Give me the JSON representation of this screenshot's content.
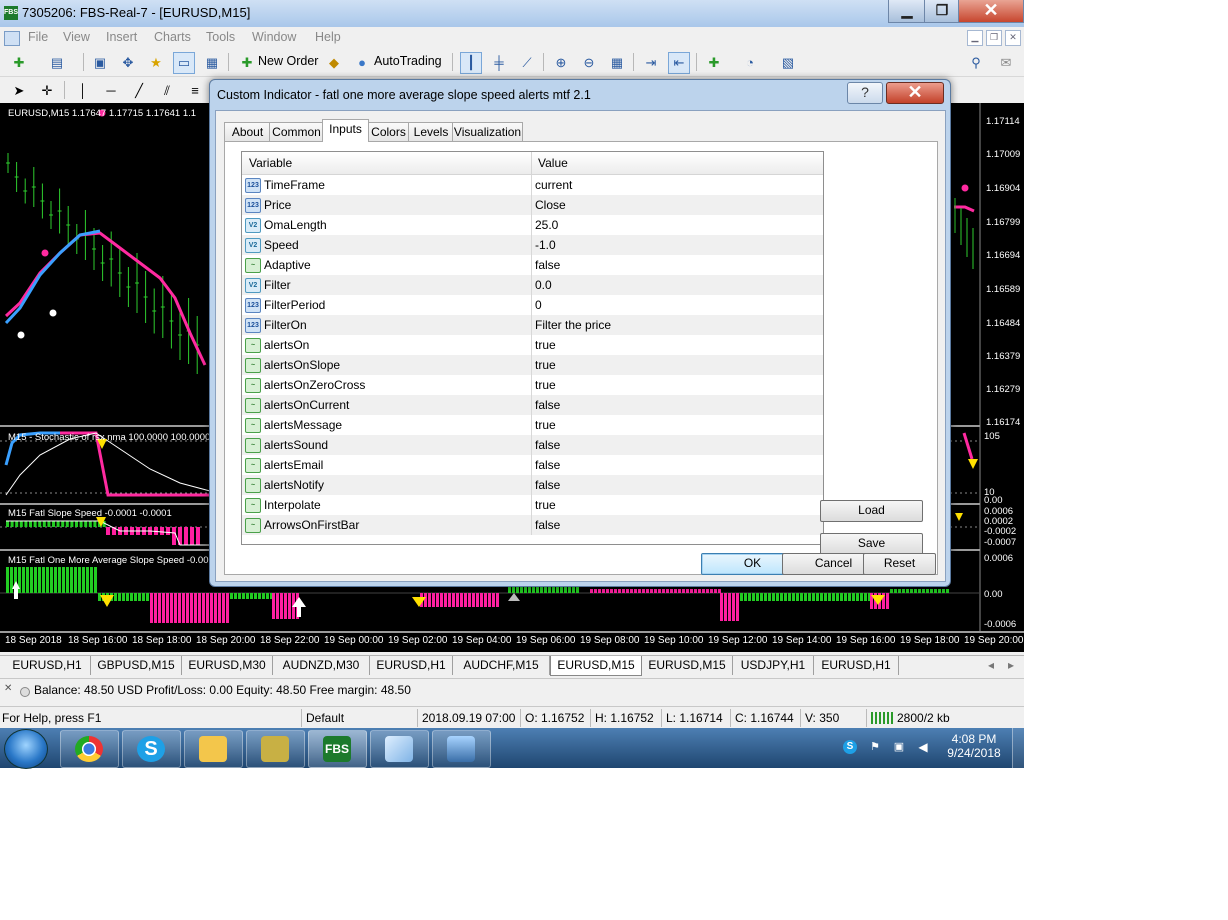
{
  "window": {
    "app_icon": "FBS",
    "title": "7305206: FBS-Real-7 - [EURUSD,M15]",
    "buttons": {
      "minimize": "▁",
      "maximize": "❐",
      "close": "✕"
    }
  },
  "menu": [
    "File",
    "View",
    "Insert",
    "Charts",
    "Tools",
    "Window",
    "Help"
  ],
  "toolbar": {
    "new_order": "New Order",
    "autotrading": "AutoTrading"
  },
  "chart": {
    "main_title": "EURUSD,M15  1.17647 1.17715 1.17641 1.1",
    "price_labels": [
      "1.17114",
      "1.17009",
      "1.16904",
      "1.16799",
      "1.16694",
      "1.16589",
      "1.16484",
      "1.16379",
      "1.16279",
      "1.16174"
    ],
    "stoch_title": "M15 - Stochastic of rsx nma 100.0000 100.0000",
    "stoch_labels": [
      "105",
      "10",
      "0.00"
    ],
    "slope_title": "M15 Fatl Slope Speed -0.0001 -0.0001",
    "slope_labels": [
      "0.0006",
      "0.0002",
      "-0.0002",
      "-0.0007"
    ],
    "fatl_title": "M15 Fatl One More Average Slope Speed -0.00",
    "fatl_labels": [
      "0.0006",
      "0.00",
      "-0.0006"
    ],
    "time_labels": [
      "18 Sep 2018",
      "18 Sep 16:00",
      "18 Sep 18:00",
      "18 Sep 20:00",
      "18 Sep 22:00",
      "19 Sep 00:00",
      "19 Sep 02:00",
      "19 Sep 04:00",
      "19 Sep 06:00",
      "19 Sep 08:00",
      "19 Sep 10:00",
      "19 Sep 12:00",
      "19 Sep 14:00",
      "19 Sep 16:00",
      "19 Sep 18:00",
      "19 Sep 20:00"
    ]
  },
  "chart_tabs": {
    "items": [
      "EURUSD,H1",
      "GBPUSD,M15",
      "EURUSD,M30",
      "AUDNZD,M30",
      "EURUSD,H1",
      "AUDCHF,M15",
      "EURUSD,M15",
      "EURUSD,M15",
      "USDJPY,H1",
      "EURUSD,H1"
    ],
    "active_index": 6,
    "scroll_left": "◂",
    "scroll_right": "▸"
  },
  "balance": {
    "close": "✕",
    "text": "Balance: 48.50 USD  Profit/Loss: 0.00  Equity: 48.50  Free margin: 48.50"
  },
  "status": {
    "help": "For Help, press F1",
    "profile": "Default",
    "datetime": "2018.09.19 07:00",
    "open": "O: 1.16752",
    "high": "H: 1.16752",
    "low": "L: 1.16714",
    "close": "C: 1.16744",
    "volume": "V: 350",
    "traffic": "2800/2 kb"
  },
  "taskbar": {
    "apps": [
      "chrome",
      "skype",
      "explorer",
      "mt4-folder",
      "FBS",
      "notes",
      "photos"
    ],
    "fbs_label": "FBS",
    "time": "4:08 PM",
    "date": "9/24/2018"
  },
  "dialog": {
    "title": "Custom Indicator - fatl one more average slope speed alerts mtf 2.1",
    "help_button": "?",
    "close_button": "✕",
    "tabs": [
      "About",
      "Common",
      "Inputs",
      "Colors",
      "Levels",
      "Visualization"
    ],
    "active_tab": "Inputs",
    "columns": {
      "variable": "Variable",
      "value": "Value"
    },
    "params": [
      {
        "name": "TimeFrame",
        "value": "current",
        "type": "int"
      },
      {
        "name": "Price",
        "value": "Close",
        "type": "int"
      },
      {
        "name": "OmaLength",
        "value": "25.0",
        "type": "dbl"
      },
      {
        "name": "Speed",
        "value": "-1.0",
        "type": "dbl"
      },
      {
        "name": "Adaptive",
        "value": "false",
        "type": "bool"
      },
      {
        "name": "Filter",
        "value": "0.0",
        "type": "dbl"
      },
      {
        "name": "FilterPeriod",
        "value": "0",
        "type": "int"
      },
      {
        "name": "FilterOn",
        "value": "Filter the price",
        "type": "int"
      },
      {
        "name": "alertsOn",
        "value": "true",
        "type": "bool"
      },
      {
        "name": "alertsOnSlope",
        "value": "true",
        "type": "bool"
      },
      {
        "name": "alertsOnZeroCross",
        "value": "true",
        "type": "bool"
      },
      {
        "name": "alertsOnCurrent",
        "value": "false",
        "type": "bool"
      },
      {
        "name": "alertsMessage",
        "value": "true",
        "type": "bool"
      },
      {
        "name": "alertsSound",
        "value": "false",
        "type": "bool"
      },
      {
        "name": "alertsEmail",
        "value": "false",
        "type": "bool"
      },
      {
        "name": "alertsNotify",
        "value": "false",
        "type": "bool"
      },
      {
        "name": "Interpolate",
        "value": "true",
        "type": "bool"
      },
      {
        "name": "ArrowsOnFirstBar",
        "value": "false",
        "type": "bool"
      }
    ],
    "icon_labels": {
      "int": "123",
      "dbl": "V2",
      "bool": "~"
    },
    "buttons": {
      "load": "Load",
      "save": "Save",
      "ok": "OK",
      "cancel": "Cancel",
      "reset": "Reset"
    }
  },
  "colors": {
    "candle_up": "#2ecc2e",
    "line_magenta": "#ff2aa0",
    "line_blue": "#3aa0ff",
    "histogram_green": "#22cc22",
    "histogram_magenta": "#ff1fa0",
    "arrow_yellow": "#ffe000"
  }
}
